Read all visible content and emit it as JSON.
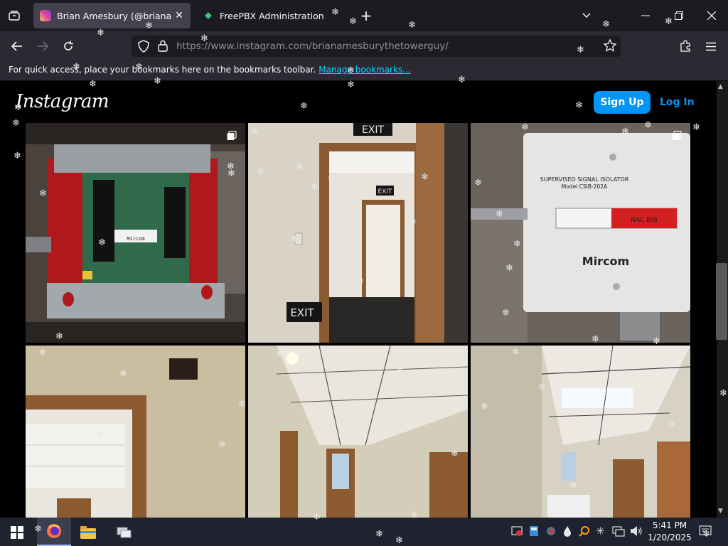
{
  "browser": {
    "tabs": [
      {
        "title": "Brian Amesbury (@brianamesbu",
        "active": true,
        "favicon": "instagram-icon"
      },
      {
        "title": "FreePBX Administration",
        "active": false,
        "favicon": "freepbx-icon"
      }
    ],
    "url_prefix": "https://www.instagram.com",
    "url_path": "/brianamesburythetowerguy/",
    "bookmarks_message": "For quick access, place your bookmarks here on the bookmarks toolbar.",
    "bookmarks_link": "Manage bookmarks..."
  },
  "instagram": {
    "logo": "Instagram",
    "signup_label": "Sign Up",
    "login_label": "Log In",
    "photo_labels": {
      "exit_top": "EXIT",
      "exit_mid": "EXIT",
      "exit_bottom": "EXIT",
      "isolator_title": "SUPERVISED SIGNAL ISOLATOR",
      "isolator_model": "Model CSIB-202A",
      "isolator_tag": "NAC B/B",
      "isolator_brand": "Mircom",
      "board_label": "Mircom"
    }
  },
  "taskbar": {
    "time": "5:41 PM",
    "date": "1/20/2025"
  },
  "colors": {
    "accent_blue": "#0095f6",
    "link_cyan": "#00ddff"
  }
}
